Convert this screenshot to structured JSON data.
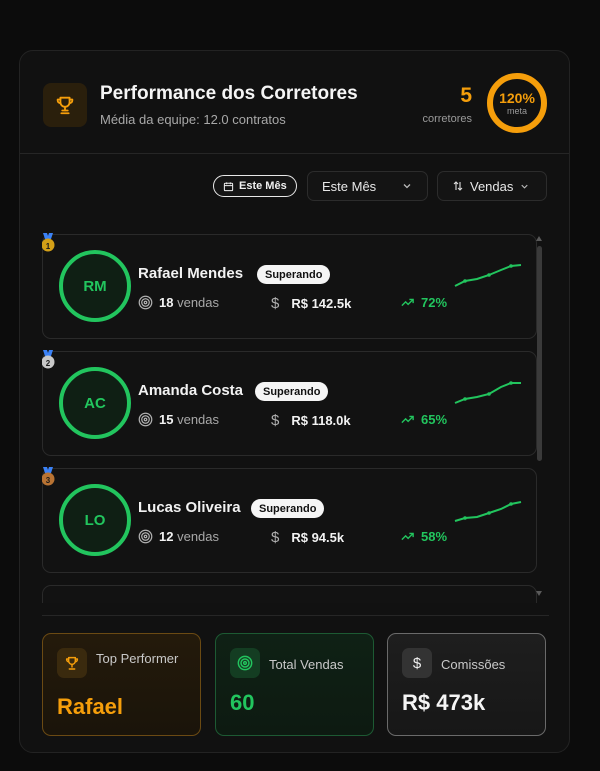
{
  "header": {
    "title": "Performance dos Corretores",
    "subtitle": "Média da equipe: 12.0 contratos",
    "broker_count": "5",
    "broker_count_label": "corretores",
    "goal_percent": "120%",
    "goal_label": "meta",
    "goal_fraction": 1.0
  },
  "filters": {
    "date_pill": "Este Mês",
    "period_select": "Este Mês",
    "sort_select": "Vendas"
  },
  "brokers": [
    {
      "rank": "1",
      "initials": "RM",
      "name": "Rafael Mendes",
      "status": "Superando",
      "sales": "18",
      "sales_unit": "vendas",
      "revenue": "R$ 142.5k",
      "growth": "72%"
    },
    {
      "rank": "2",
      "initials": "AC",
      "name": "Amanda Costa",
      "status": "Superando",
      "sales": "15",
      "sales_unit": "vendas",
      "revenue": "R$ 118.0k",
      "growth": "65%"
    },
    {
      "rank": "3",
      "initials": "LO",
      "name": "Lucas Oliveira",
      "status": "Superando",
      "sales": "12",
      "sales_unit": "vendas",
      "revenue": "R$ 94.5k",
      "growth": "58%"
    }
  ],
  "summary": {
    "top_performer_label": "Top Performer",
    "top_performer_value": "Rafael",
    "total_sales_label": "Total Vendas",
    "total_sales_value": "60",
    "commissions_label": "Comissões",
    "commissions_value": "R$ 473k"
  },
  "colors": {
    "accent_orange": "#f59e0b",
    "accent_green": "#22c55e",
    "medal_gold": "#d4a017",
    "medal_silver": "#c8c8c8",
    "medal_bronze": "#b87333"
  },
  "icons": {
    "header": "trophy-icon",
    "date_pill": "calendar-icon",
    "sort": "sort-arrows-icon",
    "sales": "target-icon",
    "revenue": "dollar-icon",
    "growth": "trending-up-icon"
  }
}
